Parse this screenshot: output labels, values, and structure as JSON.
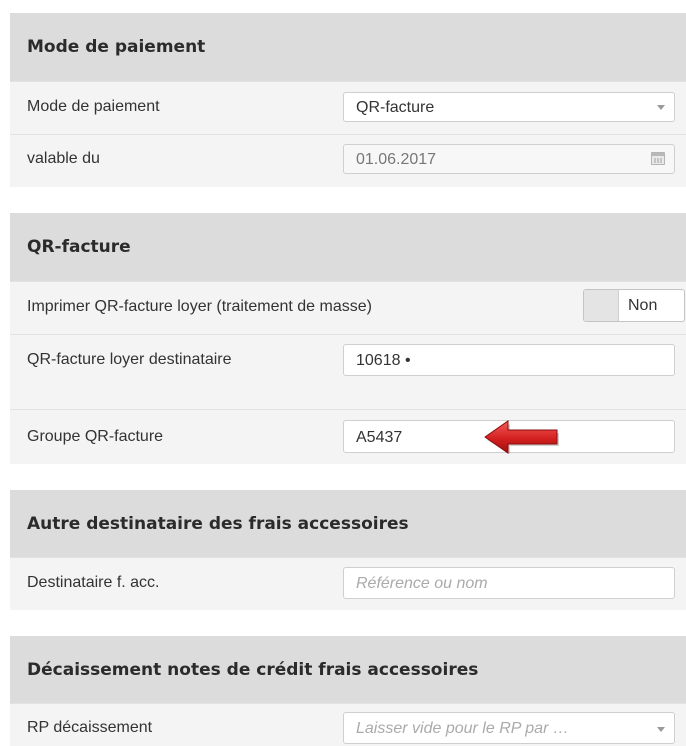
{
  "payment": {
    "title": "Mode de paiement",
    "mode_label": "Mode de paiement",
    "mode_value": "QR-facture",
    "valid_label": "valable du",
    "valid_value": "01.06.2017"
  },
  "qr": {
    "title": "QR-facture",
    "print_label": "Imprimer QR-facture loyer (traitement de masse)",
    "print_value": "Non",
    "recipient_label": "QR-facture loyer destinataire",
    "recipient_value": "10618 •",
    "group_label": "Groupe QR-facture",
    "group_value": "A5437"
  },
  "other_recipient": {
    "title": "Autre destinataire des frais accessoires",
    "label": "Destinataire f. acc.",
    "placeholder": "Référence ou nom"
  },
  "disbursement": {
    "title": "Décaissement notes de crédit frais accessoires",
    "label": "RP décaissement",
    "placeholder": "Laisser vide pour le RP par …"
  },
  "annotation": {
    "arrow_color": "#d42020"
  }
}
